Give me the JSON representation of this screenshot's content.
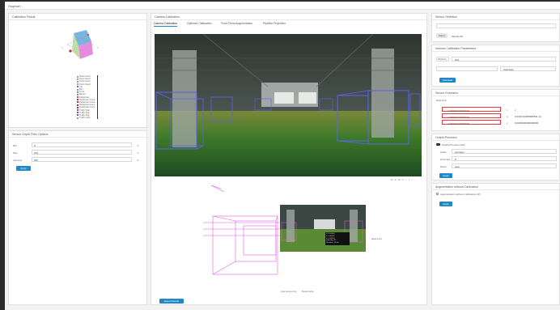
{
  "app": {
    "title": "Hugewin"
  },
  "left": {
    "calib_panel_title": "Calibration Result",
    "legend": [
      "Point Cloud",
      "Point Cloud",
      "Point Cloud",
      "Point Cloud",
      "Car",
      "Bus",
      "Truck",
      "Barrier",
      "Pedestrian",
      "Pedestrian Cone",
      "Pedestrian Cone",
      "Pedestrian Cone",
      "Pedestrian Cone",
      "Traffic Sign",
      "Traffic Sign",
      "Traffic Sign",
      "Traffic Light"
    ],
    "legend_colors": [
      "#9e9e9e",
      "#9e9e9e",
      "#9e9e9e",
      "#9e9e9e",
      "#5b6bd1",
      "#6a9fd6",
      "#45a58b",
      "#e07b39",
      "#b44ba3",
      "#b02e37",
      "#b02e37",
      "#b02e37",
      "#b02e37",
      "#7a4fb8",
      "#7a4fb8",
      "#7a4fb8",
      "#a0a0a0"
    ],
    "params_title": "Sensor Depth Filter Options",
    "rows": [
      {
        "label": "Min",
        "value": "0",
        "unit": "m"
      },
      {
        "label": "Max",
        "value": "100",
        "unit": "m"
      },
      {
        "label": "Intensity",
        "value": "255",
        "unit": "m"
      }
    ],
    "apply_label": "Apply"
  },
  "center": {
    "title": "Camera Calibration",
    "tabs": [
      "Camera Calibration",
      "Optimize Calibration",
      "Point Cloud Augmentation",
      "Pipeline Projection"
    ],
    "toolbar_icons": [
      "zoom-in-icon",
      "zoom-out-icon",
      "pan-icon",
      "rotate-icon",
      "reset-icon",
      "download-icon",
      "fullscreen-icon"
    ],
    "float_label": "label point",
    "overlay_lines": [
      "X: 0.00000",
      "Y: 0.00000",
      "Z: 0.00000",
      "Intensity: 42",
      "Distance: 12.4m"
    ],
    "footer": {
      "left": "view camera img",
      "right": "Reset points"
    },
    "export_label": "Export Result"
  },
  "right": {
    "sensor_title": "Sensor Selection",
    "sensor_btn": "Select",
    "sensor_value": "Sensor 00",
    "intrinsic_title": "Intrinsic Calibration Parameters",
    "intrinsic_value": "fx/fy/cx/cy",
    "intrinsic_sub": "Dist",
    "intrinsic_ext": "Calculate",
    "intrinsic_apply": "Calculate",
    "extrinsic_title": "Sensor Extrinsics",
    "extrinsic_sub": "Data Sub",
    "ext_rows": [
      {
        "value": "0.0000000000000000",
        "label": "r",
        "side": "x"
      },
      {
        "value": "0.0000000000000000",
        "label": "p",
        "side": "0.0111312480905511 14"
      },
      {
        "value": "0.0000000000000000",
        "label": "y",
        "side": "0.0000000000000000"
      }
    ],
    "target_title": "Output Precision",
    "target_check": "Enable Precision Edit",
    "target_rows": [
      {
        "label": "Scale",
        "value": "precision"
      },
      {
        "label": "Decimals",
        "value": "8"
      },
      {
        "label": "Mode",
        "value": "auto"
      }
    ],
    "target_apply": "Apply",
    "aug_title": "Augmentation without Calibration",
    "aug_check": "Augmentation without Calibration API",
    "aug_apply": "Apply"
  }
}
